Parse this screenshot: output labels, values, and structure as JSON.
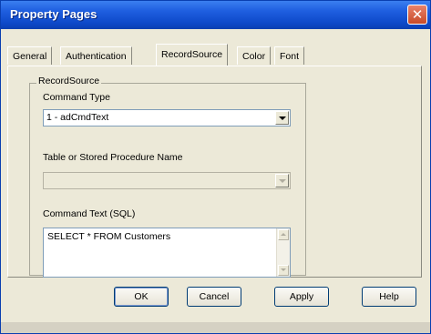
{
  "window": {
    "title": "Property Pages"
  },
  "tabs": [
    {
      "label": "General",
      "active": false
    },
    {
      "label": "Authentication",
      "active": false
    },
    {
      "label": "RecordSource",
      "active": true
    },
    {
      "label": "Color",
      "active": false
    },
    {
      "label": "Font",
      "active": false
    }
  ],
  "recordsource": {
    "group_label": "RecordSource",
    "command_type_label": "Command Type",
    "command_type_value": "1 - adCmdText",
    "table_label": "Table or Stored Procedure Name",
    "table_value": "",
    "command_text_label": "Command Text (SQL)",
    "command_text_value": "SELECT * FROM Customers"
  },
  "buttons": {
    "ok": "OK",
    "cancel": "Cancel",
    "apply": "Apply",
    "help": "Help"
  },
  "colors": {
    "titlebar": "#0d48c8",
    "face": "#ece9d8",
    "border": "#003c74"
  },
  "icons": {
    "close": "close-icon",
    "dropdown": "chevron-down-icon"
  }
}
